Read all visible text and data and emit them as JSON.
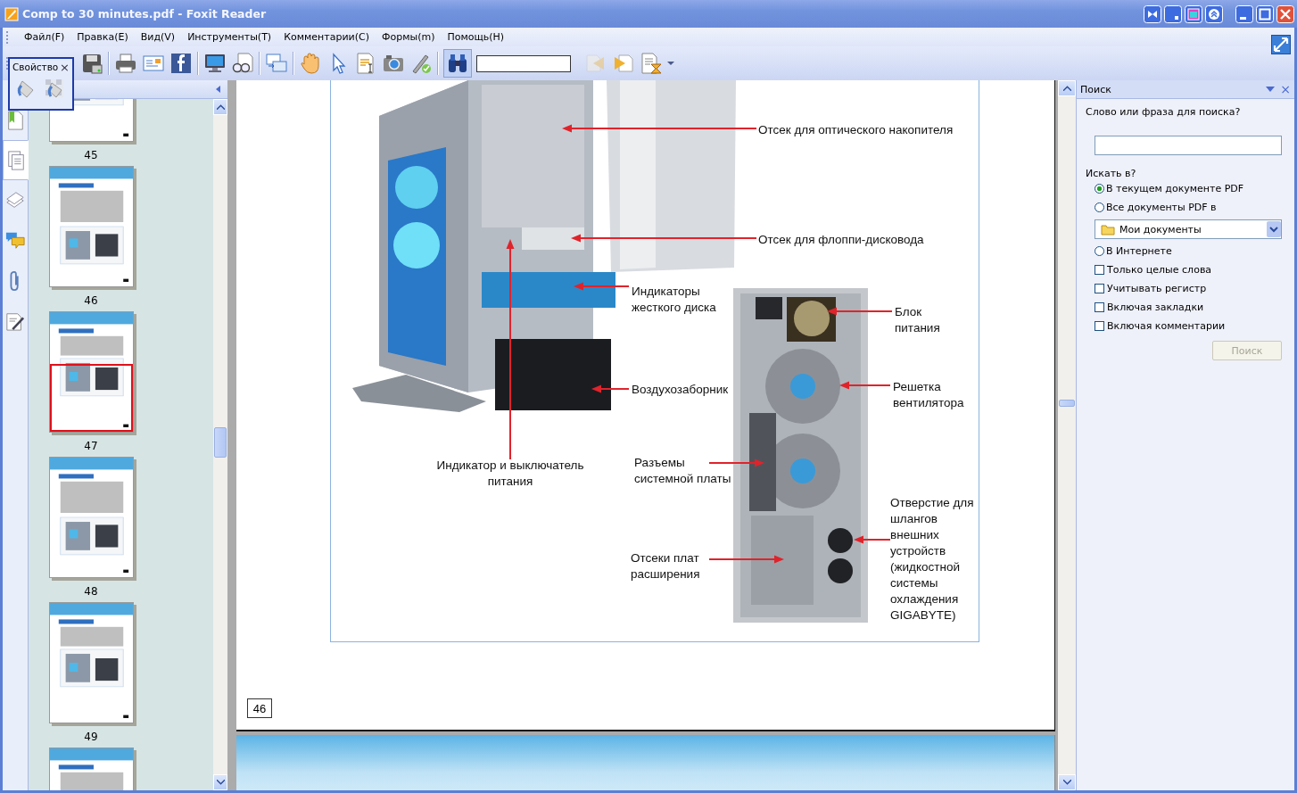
{
  "window": {
    "title": "Comp to 30 minutes.pdf - Foxit Reader"
  },
  "menu": [
    "Файл(F)",
    "Правка(E)",
    "Вид(V)",
    "Инструменты(T)",
    "Комментарии(C)",
    "Формы(m)",
    "Помощь(H)"
  ],
  "toolbar": {
    "find_active": true
  },
  "property_popup": {
    "title": "Свойство",
    "close": "×"
  },
  "side_tabs": [
    {
      "kind": "bookmarks",
      "selected": false
    },
    {
      "kind": "pages",
      "selected": true
    },
    {
      "kind": "layers",
      "selected": false
    },
    {
      "kind": "comments",
      "selected": false
    },
    {
      "kind": "attachments",
      "selected": false
    },
    {
      "kind": "signatures",
      "selected": false
    }
  ],
  "thumbnails": [
    {
      "page": "45",
      "selected": false
    },
    {
      "page": "46",
      "selected": false
    },
    {
      "page": "47",
      "selected": true
    },
    {
      "page": "48",
      "selected": false
    },
    {
      "page": "49",
      "selected": false
    },
    {
      "selected": false
    }
  ],
  "document": {
    "labels": [
      {
        "lines": [
          "Отсек для оптического накопителя"
        ]
      },
      {
        "lines": [
          "Отсек для флоппи-дисковода"
        ]
      },
      {
        "lines": [
          "Индикаторы",
          "жесткого диска"
        ]
      },
      {
        "lines": [
          "Блок",
          "питания"
        ]
      },
      {
        "lines": [
          "Воздухозаборник"
        ]
      },
      {
        "lines": [
          "Решетка",
          "вентилятора"
        ]
      },
      {
        "lines": [
          "Индикатор и выключатель",
          "питания"
        ]
      },
      {
        "lines": [
          "Разъемы",
          "системной платы"
        ]
      },
      {
        "lines": [
          "Отсеки плат",
          "расширения"
        ]
      },
      {
        "lines": [
          "Отверстие для",
          "шлангов",
          "внешних",
          "устройств",
          "(жидкостной",
          "системы",
          "охлаждения",
          "GIGABYTE)"
        ]
      }
    ],
    "page_number": "46"
  },
  "search_panel": {
    "title": "Поиск",
    "close": "×",
    "prompt": "Слово или фраза для поиска?",
    "scope_label": "Искать в?",
    "scopes": [
      {
        "label": "В текущем документе PDF",
        "selected": true
      },
      {
        "label": "Все документы PDF в",
        "selected": false,
        "folder": "Мои документы"
      },
      {
        "label": "В Интернете",
        "selected": false
      }
    ],
    "options": [
      {
        "label": "Только целые слова",
        "checked": false
      },
      {
        "label": "Учитывать регистр",
        "checked": false
      },
      {
        "label": "Включая закладки",
        "checked": false
      },
      {
        "label": "Включая комментарии",
        "checked": false
      }
    ],
    "button": {
      "label": "Поиск",
      "disabled": true
    }
  }
}
